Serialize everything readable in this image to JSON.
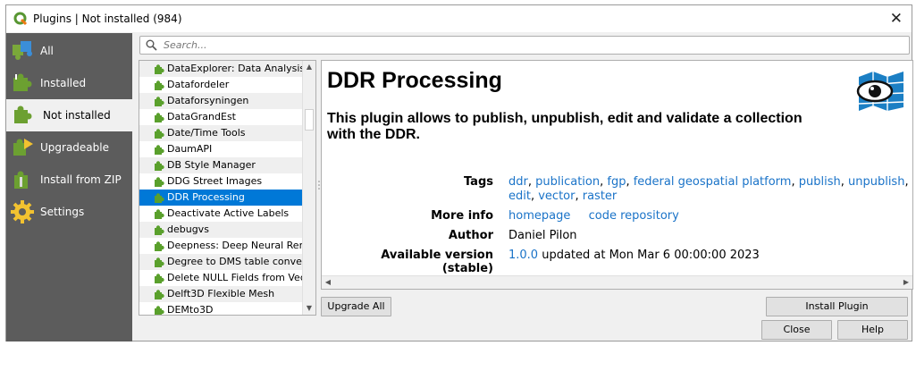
{
  "window": {
    "title": "Plugins | Not installed (984)",
    "close_glyph": "✕"
  },
  "sidebar": {
    "items": [
      {
        "label": "All",
        "icon": "puzzle-all-icon"
      },
      {
        "label": "Installed",
        "icon": "puzzle-installed-icon"
      },
      {
        "label": "Not installed",
        "icon": "puzzle-not-installed-icon"
      },
      {
        "label": "Upgradeable",
        "icon": "puzzle-upgradeable-icon"
      },
      {
        "label": "Install from ZIP",
        "icon": "zip-install-icon"
      },
      {
        "label": "Settings",
        "icon": "settings-gear-icon"
      }
    ],
    "active_index": 2
  },
  "search": {
    "placeholder": "Search...",
    "value": ""
  },
  "plugin_list": {
    "items": [
      "DataExplorer: Data Analysis and Visualization",
      "Datafordeler",
      "Dataforsyningen",
      "DataGrandEst",
      "Date/Time Tools",
      "DaumAPI",
      "DB Style Manager",
      "DDG Street Images",
      "DDR Processing",
      "Deactivate Active Labels",
      "debugvs",
      "Deepness: Deep Neural Remote Sensing",
      "Degree to DMS table converter",
      "Delete NULL Fields from Vector",
      "Delft3D Flexible Mesh",
      "DEMto3D"
    ],
    "selected_index": 8,
    "scroll_up": "▲",
    "scroll_down": "▼"
  },
  "details": {
    "title": "DDR Processing",
    "description": "This plugin allows to publish, unpublish, edit and validate a collection with the DDR.",
    "labels": {
      "tags": "Tags",
      "more_info": "More info",
      "author": "Author",
      "available_version": "Available version (stable)"
    },
    "tags": [
      "ddr",
      "publication",
      "fgp",
      "federal geospatial platform",
      "publish",
      "unpublish",
      "edit",
      "vector",
      "raster"
    ],
    "tag_separator": ", ",
    "more_info_links": {
      "homepage": "homepage",
      "code_repository": "code repository"
    },
    "author": "Daniel Pilon",
    "version": "1.0.0",
    "updated_text": " updated at Mon Mar 6 00:00:00 2023",
    "scroll_left": "◀",
    "scroll_right": "▶",
    "logo_icon": "eye-map-logo-icon"
  },
  "buttons": {
    "upgrade_all": "Upgrade All",
    "install_plugin": "Install Plugin",
    "close": "Close",
    "help": "Help"
  },
  "colors": {
    "sidebar_bg": "#5c5c5c",
    "selection": "#0078d7",
    "link": "#1a73c8"
  }
}
